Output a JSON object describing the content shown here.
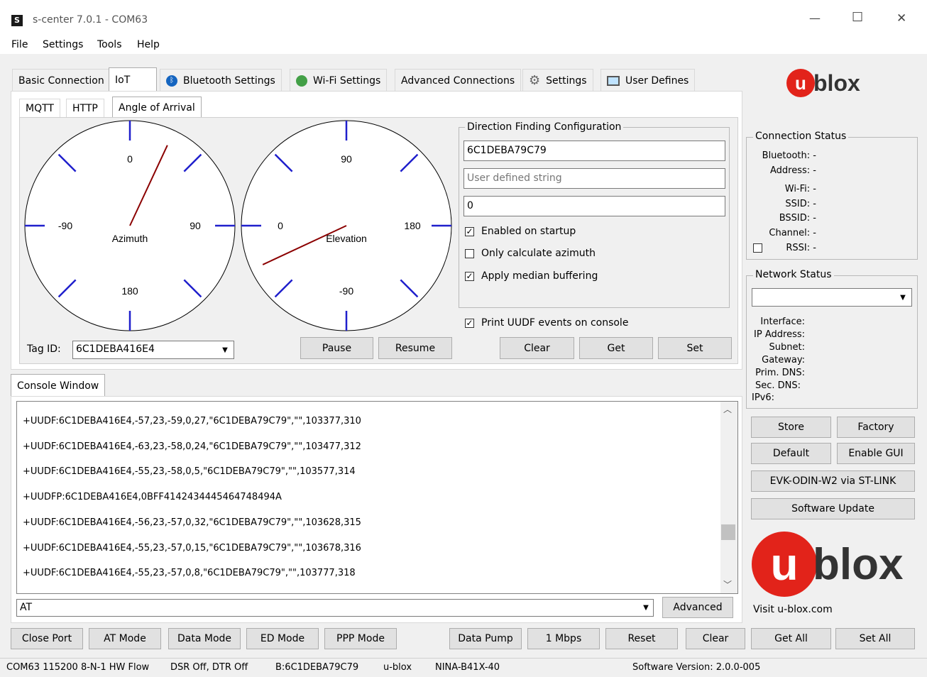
{
  "window": {
    "app_icon": "S",
    "title": "s-center 7.0.1 - COM63",
    "minimize": "—",
    "maximize": "☐",
    "close": "✕"
  },
  "menu": [
    "File",
    "Settings",
    "Tools",
    "Help"
  ],
  "main_tabs": [
    "Basic Connection",
    "IoT",
    "Bluetooth Settings",
    "Wi-Fi Settings",
    "Advanced Connections",
    "Settings",
    "User Defines"
  ],
  "sub_tabs": [
    "MQTT",
    "HTTP",
    "Angle of Arrival"
  ],
  "azimuth": {
    "label": "Azimuth",
    "top": "0",
    "right": "90",
    "bottom": "180",
    "left": "-90",
    "needle_deg": 25
  },
  "elevation": {
    "label": "Elevation",
    "top": "90",
    "right": "180",
    "bottom": "-90",
    "left": "0",
    "needle_deg": 25
  },
  "tag": {
    "label": "Tag ID:",
    "value": "6C1DEBA416E4"
  },
  "dfc": {
    "title": "Direction Finding Configuration",
    "anchor_id": "6C1DEBA79C79",
    "user_string_placeholder": "User defined string",
    "number": "0",
    "enabled_on_startup": "Enabled on startup",
    "only_azimuth": "Only calculate azimuth",
    "median_buffering": "Apply median buffering",
    "print_uudf": "Print UUDF events on console"
  },
  "aoa_buttons": {
    "pause": "Pause",
    "resume": "Resume",
    "clear": "Clear",
    "get": "Get",
    "set": "Set"
  },
  "console": {
    "tab": "Console Window",
    "lines": [
      "+UUDF:6C1DEBA416E4,-57,23,-59,0,27,\"6C1DEBA79C79\",\"\",103377,310",
      "+UUDF:6C1DEBA416E4,-63,23,-58,0,24,\"6C1DEBA79C79\",\"\",103477,312",
      "+UUDF:6C1DEBA416E4,-55,23,-58,0,5,\"6C1DEBA79C79\",\"\",103577,314",
      "+UUDFP:6C1DEBA416E4,0BFF4142434445464748494A",
      "+UUDF:6C1DEBA416E4,-56,23,-57,0,32,\"6C1DEBA79C79\",\"\",103628,315",
      "+UUDF:6C1DEBA416E4,-55,23,-57,0,15,\"6C1DEBA79C79\",\"\",103678,316",
      "+UUDF:6C1DEBA416E4,-55,23,-57,0,8,\"6C1DEBA79C79\",\"\",103777,318"
    ],
    "command": "AT",
    "advanced": "Advanced"
  },
  "bottom_buttons": [
    "Close Port",
    "AT Mode",
    "Data Mode",
    "ED Mode",
    "PPP Mode",
    "Data Pump",
    "1 Mbps",
    "Reset",
    "Clear",
    "Get All",
    "Set All"
  ],
  "brand": {
    "u": "u",
    "blox": "blox",
    "visit": "Visit u-blox.com"
  },
  "connection_status": {
    "title": "Connection Status",
    "rows": [
      {
        "label": "Bluetooth:",
        "value": "-"
      },
      {
        "label": "Address:",
        "value": "-"
      },
      {
        "label": "Wi-Fi:",
        "value": "-"
      },
      {
        "label": "SSID:",
        "value": "-"
      },
      {
        "label": "BSSID:",
        "value": "-"
      },
      {
        "label": "Channel:",
        "value": "-"
      },
      {
        "label": "RSSI:",
        "value": "-"
      }
    ]
  },
  "network_status": {
    "title": "Network Status",
    "labels": [
      "Interface:",
      "IP Address:",
      "Subnet:",
      "Gateway:",
      "Prim. DNS:",
      "Sec. DNS:",
      "IPv6:"
    ]
  },
  "side_buttons": {
    "store": "Store",
    "factory": "Factory",
    "default": "Default",
    "enable_gui": "Enable GUI",
    "evk": "EVK-ODIN-W2 via ST-LINK",
    "software_update": "Software Update"
  },
  "statusbar": [
    "COM63 115200 8-N-1 HW Flow",
    "DSR Off, DTR Off",
    "B:6C1DEBA79C79",
    "u-blox",
    "NINA-B41X-40",
    "Software Version: 2.0.0-005"
  ],
  "colors": {
    "dial_tick": "#1f1fcc",
    "needle": "#8b0000",
    "brand_red": "#e2231a"
  }
}
